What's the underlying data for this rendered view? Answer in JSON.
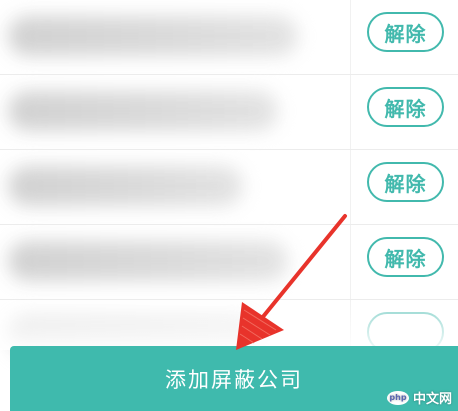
{
  "blocked_list": {
    "rows": [
      {
        "action_label": "解除"
      },
      {
        "action_label": "解除"
      },
      {
        "action_label": "解除"
      },
      {
        "action_label": "解除"
      }
    ]
  },
  "footer": {
    "add_button_label": "添加屏蔽公司"
  },
  "watermark": {
    "badge": "php",
    "text": "中文网"
  },
  "colors": {
    "accent": "#3fbaad",
    "button_outline": "#42b9ad",
    "arrow": "#e8332b"
  },
  "icons": {
    "annotation": "red-arrow-icon"
  }
}
